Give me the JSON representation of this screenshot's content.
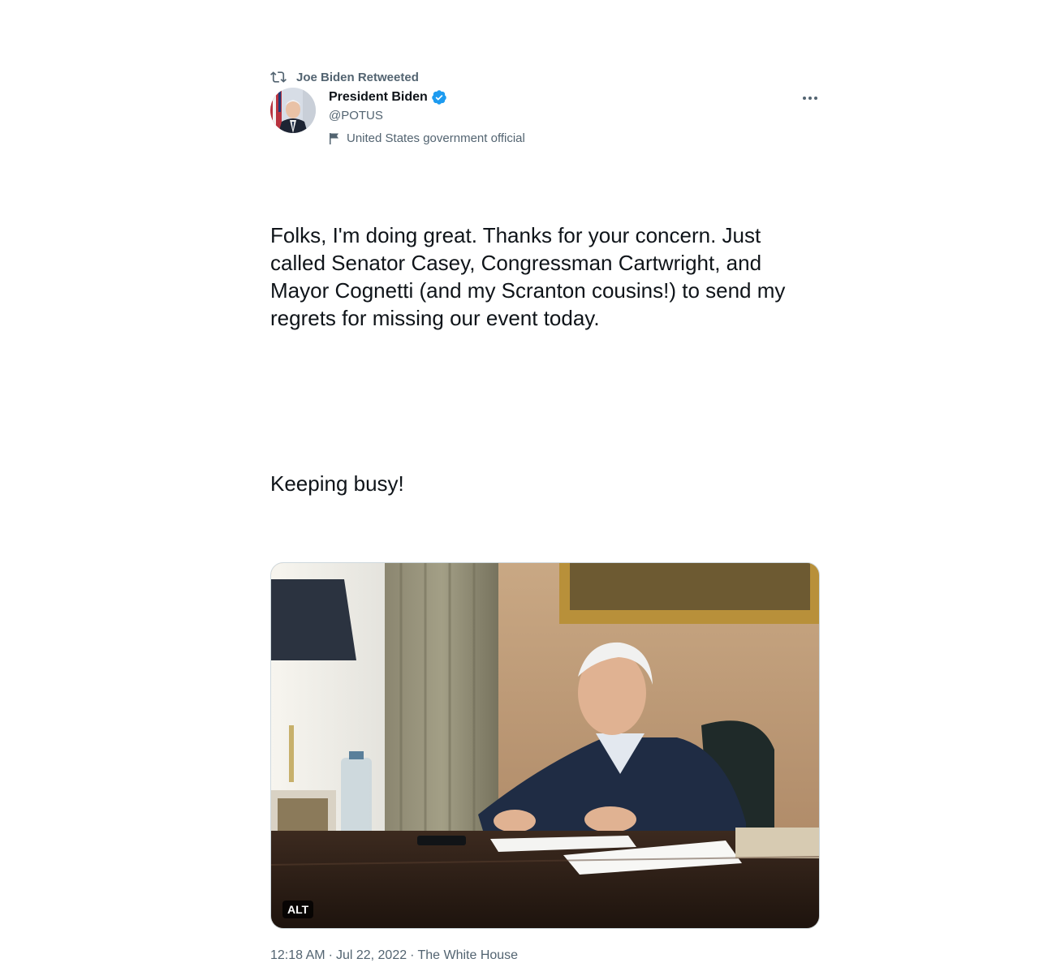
{
  "retweet": {
    "icon": "retweet-icon",
    "label": "Joe Biden Retweeted"
  },
  "author": {
    "name": "President Biden",
    "handle": "@POTUS",
    "verified_icon": "verified-badge-icon",
    "label_icon": "flag-icon",
    "label": "United States government official",
    "more_icon": "more-options-icon"
  },
  "tweet": {
    "text_line1": "Folks, I'm doing great. Thanks for your concern. Just called Senator Casey, Congressman Cartwright, and Mayor Cognetti (and my Scranton cousins!) to send my regrets for missing our event today.",
    "text_line2": "Keeping busy!"
  },
  "media": {
    "alt_label": "ALT"
  },
  "meta": {
    "time": "12:18 AM",
    "date": "Jul 22, 2022",
    "source": "The White House",
    "separator": "·"
  },
  "colors": {
    "text_primary": "#0f1419",
    "text_secondary": "#536471",
    "verified_blue": "#1d9bf0"
  }
}
